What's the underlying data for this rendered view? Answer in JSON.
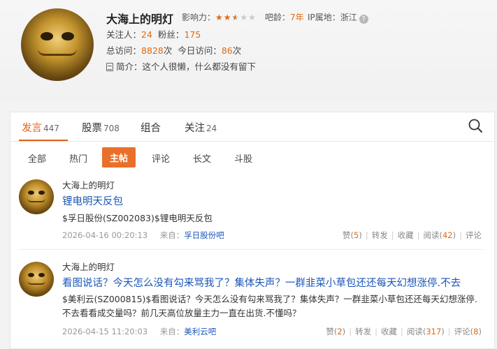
{
  "profile": {
    "name": "大海上的明灯",
    "influence_label": "影响力：",
    "influence_rating": 2.5,
    "influence_max": 5,
    "age_label": "吧龄：",
    "age_value": "7年",
    "ip_label": "IP属地：",
    "ip_value": "浙江",
    "follow_label": "关注人：",
    "follow_value": "24",
    "fans_label": "粉丝：",
    "fans_value": "175",
    "visits_label": "总访问：",
    "visits_value": "8828",
    "visits_unit": "次",
    "today_label": "今日访问：",
    "today_value": "86",
    "today_unit": "次",
    "bio_label": "简介：",
    "bio_text": "这个人很懒，什么都没有留下"
  },
  "tabs": [
    {
      "label": "发言",
      "count": "447"
    },
    {
      "label": "股票",
      "count": "708"
    },
    {
      "label": "组合",
      "count": ""
    },
    {
      "label": "关注",
      "count": "24"
    }
  ],
  "subtabs": [
    "全部",
    "热门",
    "主帖",
    "评论",
    "长文",
    "斗股"
  ],
  "posts": [
    {
      "author": "大海上的明灯",
      "title": "锂电明天反包",
      "body": "$孚日股份(SZ002083)$锂电明天反包",
      "time": "2026-04-16 00:20:13",
      "source_label": "来自：",
      "source": "孚日股份吧",
      "like_label": "赞",
      "like_count": "5",
      "repost_label": "转发",
      "fav_label": "收藏",
      "read_label": "阅读",
      "read_count": "42",
      "comment_label": "评论",
      "comment_count": ""
    },
    {
      "author": "大海上的明灯",
      "title": "看图说话？今天怎么没有勾来骂我了？集体失声？一群韭菜小草包还还每天幻想涨停.不去",
      "body": "$美利云(SZ000815)$看图说话？今天怎么没有勾来骂我了？集体失声？一群韭菜小草包还还每天幻想涨停.不去看看成交量吗？前几天高位放量主力一直在出货.不懂吗？",
      "time": "2026-04-15 11:20:03",
      "source_label": "来自：",
      "source": "美利云吧",
      "like_label": "赞",
      "like_count": "2",
      "repost_label": "转发",
      "fav_label": "收藏",
      "read_label": "阅读",
      "read_count": "317",
      "comment_label": "评论",
      "comment_count": "8"
    }
  ],
  "colors": {
    "accent": "#e0601a",
    "link": "#1a56b8",
    "number": "#e06a12"
  }
}
